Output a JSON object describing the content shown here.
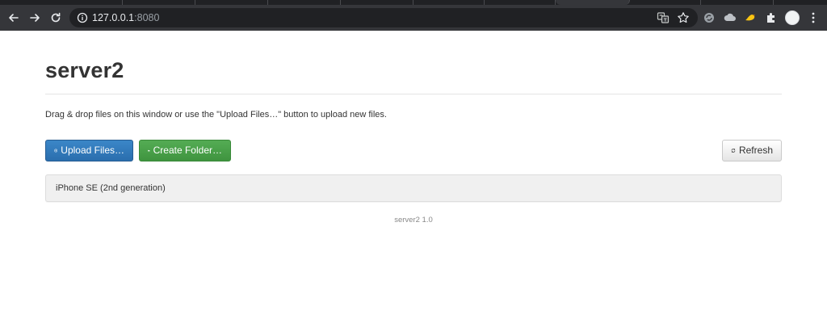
{
  "browser": {
    "url_host": "127.0.0.1",
    "url_port": ":8080",
    "icons": {
      "back": "back-arrow-icon",
      "forward": "forward-arrow-icon",
      "reload": "reload-icon",
      "site_info": "info-icon",
      "translate": "translate-icon",
      "bookmark": "star-icon",
      "extensions": "puzzle-icon",
      "menu": "kebab-menu-icon"
    }
  },
  "page": {
    "title": "server2",
    "hint": "Drag & drop files on this window or use the \"Upload Files…\" button to upload new files.",
    "buttons": {
      "upload": "Upload Files…",
      "create_folder": "Create Folder…",
      "refresh": "Refresh"
    },
    "items": [
      {
        "label": "iPhone SE (2nd generation)"
      }
    ],
    "footer": "server2 1.0"
  },
  "colors": {
    "primary": "#337ab7",
    "success": "#449d44",
    "chrome_bg": "#35363a",
    "omnibox_bg": "#202124"
  }
}
